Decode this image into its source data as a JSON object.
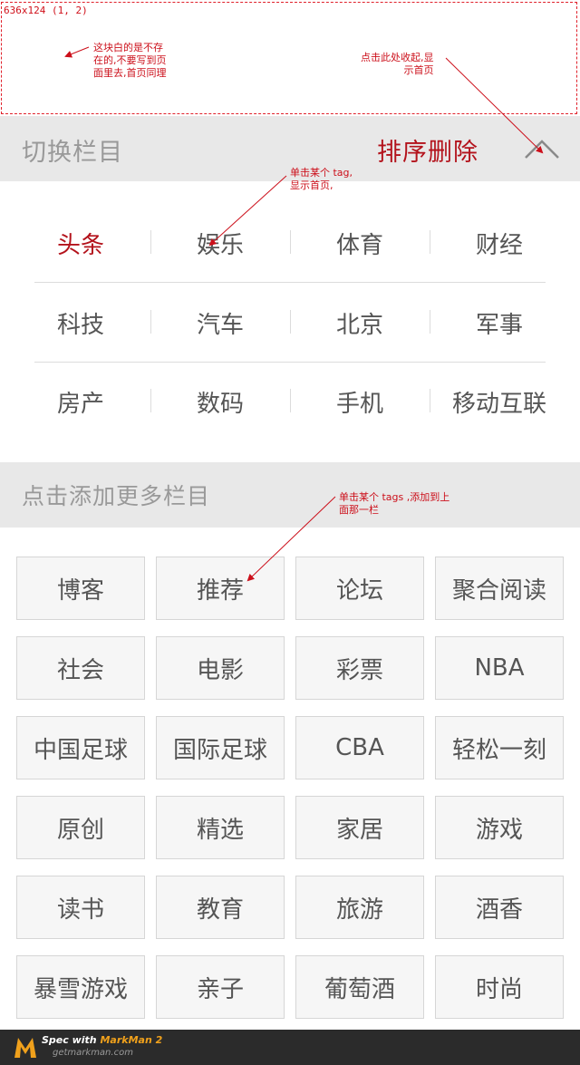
{
  "annotations": {
    "box_size": "636x124 (1, 2)",
    "note_blank_block": [
      "这块白的是不存",
      "在的,不要写到页",
      "面里去,首页同理"
    ],
    "note_collapse": [
      "点击此处收起,显",
      "示首页"
    ],
    "note_click_tag": [
      "单击某个 tag,",
      "显示首页,"
    ],
    "note_add_tag": [
      "单击某个 tags ,添加到上",
      "面那一栏"
    ],
    "accent_color": "#cc0f1a"
  },
  "header": {
    "title": "切换栏目",
    "sort_delete_label": "排序删除",
    "collapse_icon": "chevron-up-icon"
  },
  "my_tags": {
    "rows": [
      [
        "头条",
        "娱乐",
        "体育",
        "财经"
      ],
      [
        "科技",
        "汽车",
        "北京",
        "军事"
      ],
      [
        "房产",
        "数码",
        "手机",
        "移动互联"
      ]
    ],
    "active": "头条",
    "active_color": "#b3121b"
  },
  "more": {
    "title": "点击添加更多栏目",
    "rows": [
      [
        "博客",
        "推荐",
        "论坛",
        "聚合阅读"
      ],
      [
        "社会",
        "电影",
        "彩票",
        "NBA"
      ],
      [
        "中国足球",
        "国际足球",
        "CBA",
        "轻松一刻"
      ],
      [
        "原创",
        "精选",
        "家居",
        "游戏"
      ],
      [
        "读书",
        "教育",
        "旅游",
        "酒香"
      ],
      [
        "暴雪游戏",
        "亲子",
        "葡萄酒",
        "时尚"
      ]
    ]
  },
  "footer": {
    "spec_with": "Spec with ",
    "brand": "MarkMan 2",
    "site": "getmarkman.com",
    "logo_icon": "markman-logo-icon"
  }
}
